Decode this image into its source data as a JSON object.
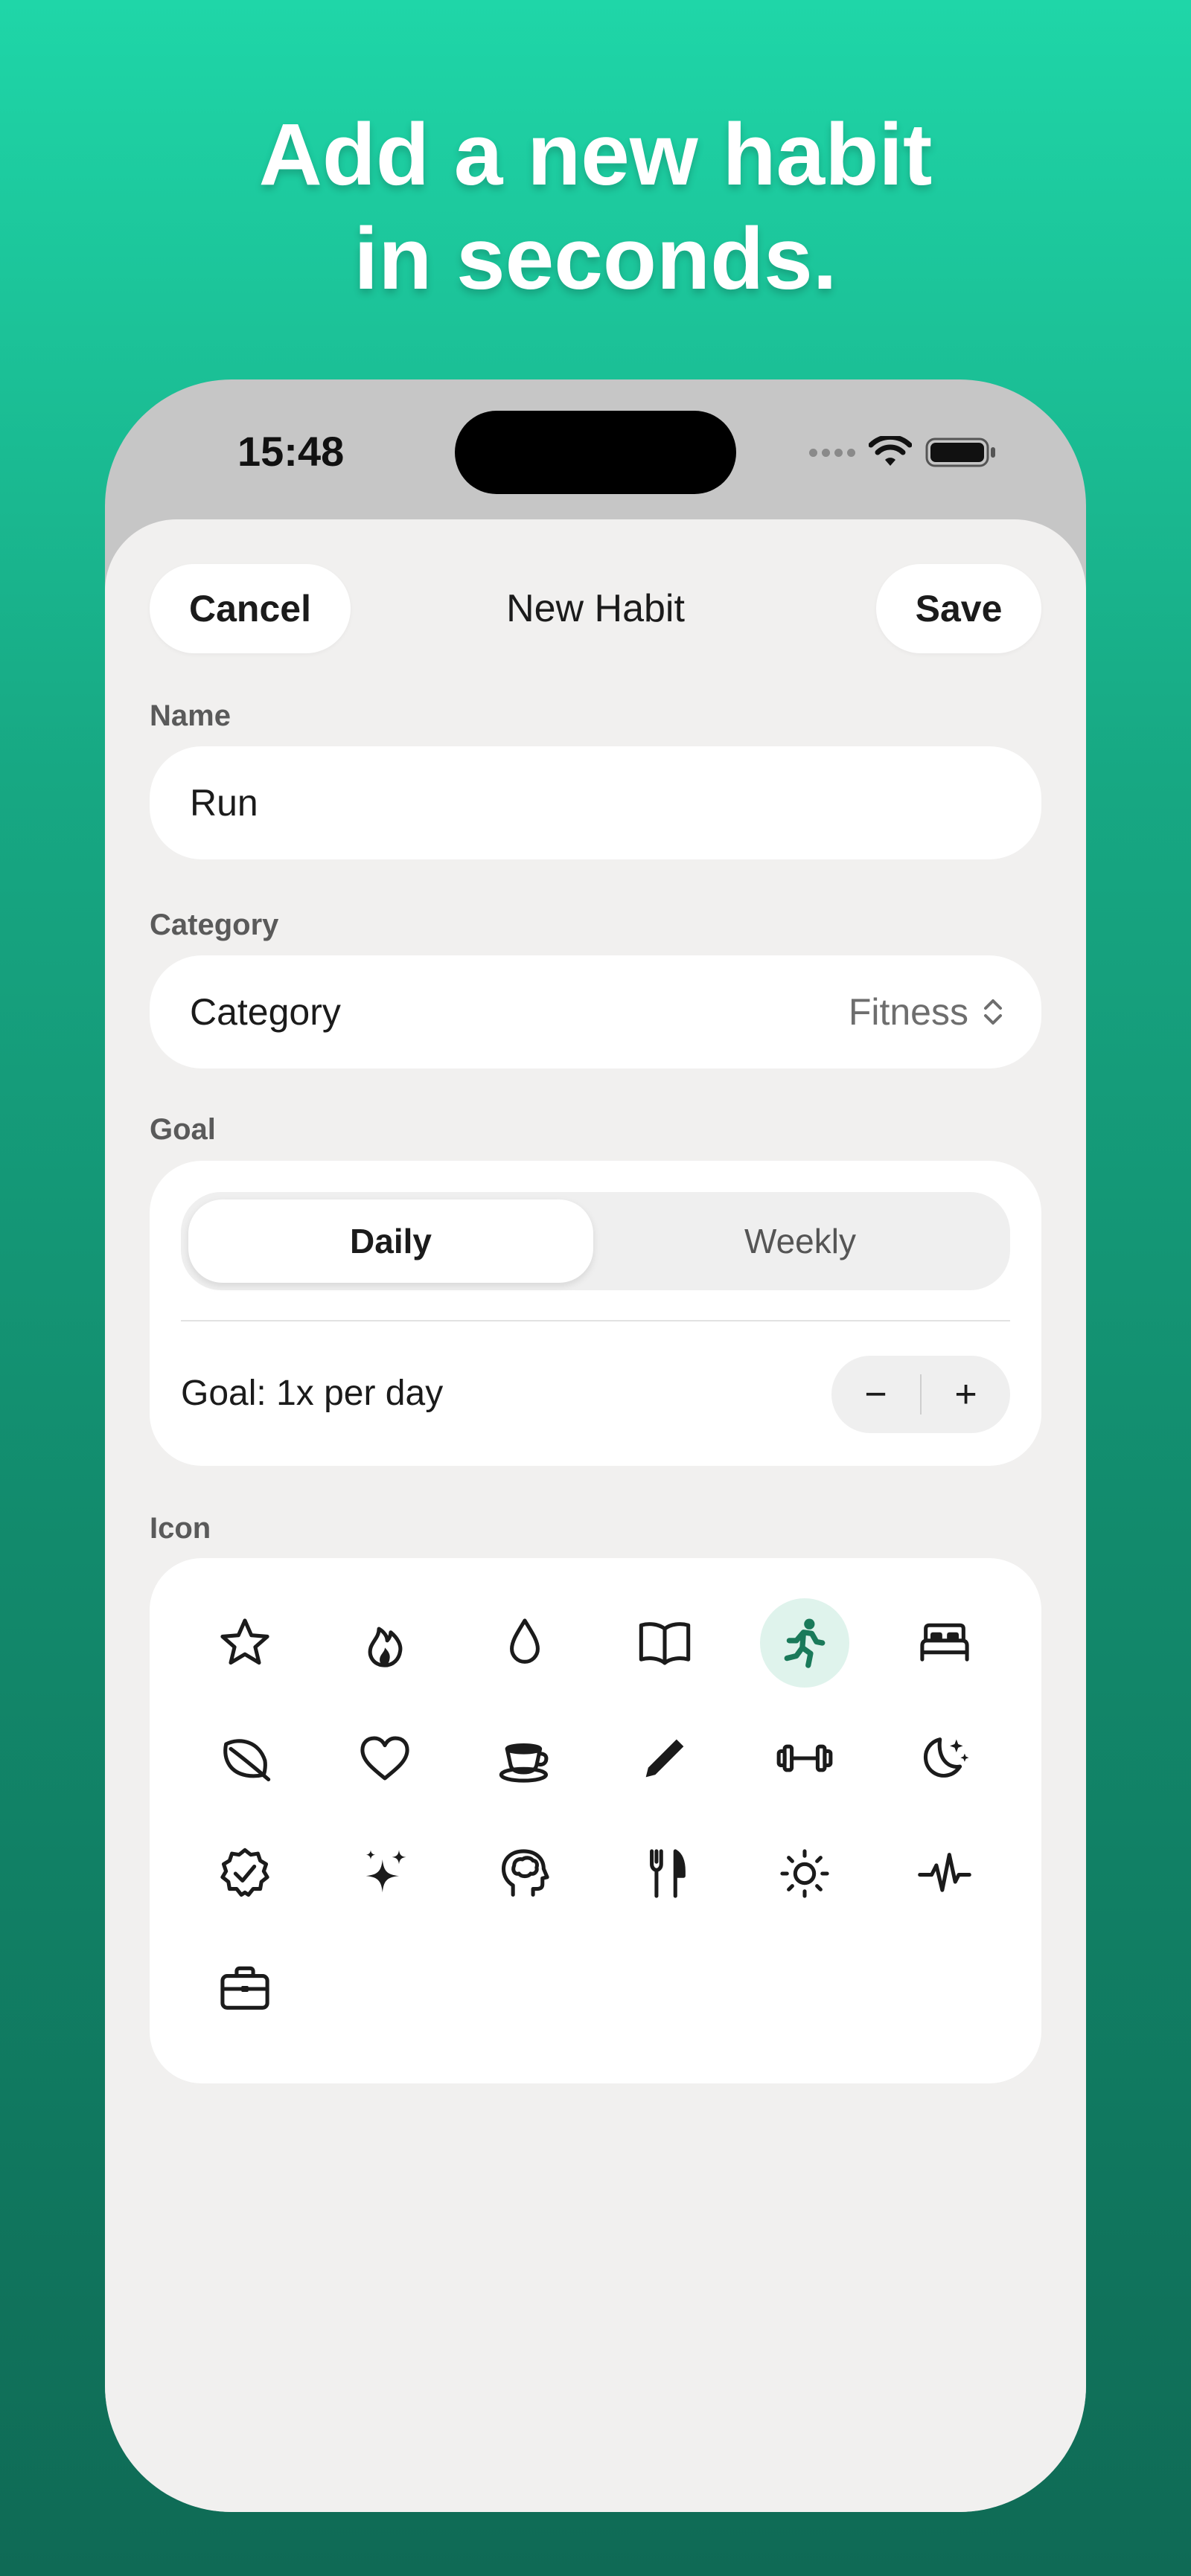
{
  "headline": {
    "line1": "Add a new habit",
    "line2": "in seconds."
  },
  "status_bar": {
    "time": "15:48",
    "icons": [
      "cellular-dots-icon",
      "wifi-icon",
      "battery-icon"
    ]
  },
  "nav": {
    "cancel_label": "Cancel",
    "title": "New Habit",
    "save_label": "Save"
  },
  "form": {
    "name": {
      "label": "Name",
      "value": "Run"
    },
    "category": {
      "label": "Category",
      "row_label": "Category",
      "value": "Fitness"
    },
    "goal": {
      "label": "Goal",
      "segments": [
        "Daily",
        "Weekly"
      ],
      "selected": "Daily",
      "text": "Goal: 1x per day",
      "minus": "−",
      "plus": "+"
    },
    "icon": {
      "label": "Icon",
      "icons": [
        "star-icon",
        "flame-icon",
        "drop-icon",
        "book-icon",
        "running-icon",
        "bed-icon",
        "leaf-icon",
        "heart-icon",
        "cup-icon",
        "pencil-icon",
        "dumbbell-icon",
        "moon-stars-icon",
        "badge-check-icon",
        "sparkles-icon",
        "brain-head-icon",
        "fork-knife-icon",
        "sun-icon",
        "heartbeat-icon",
        "briefcase-icon"
      ],
      "selected": "running-icon"
    }
  },
  "colors": {
    "accent": "#1a7a5a",
    "selected_bg": "#dff3ec",
    "background_top": "#1fd6a8",
    "background_bottom": "#0f6a55"
  }
}
